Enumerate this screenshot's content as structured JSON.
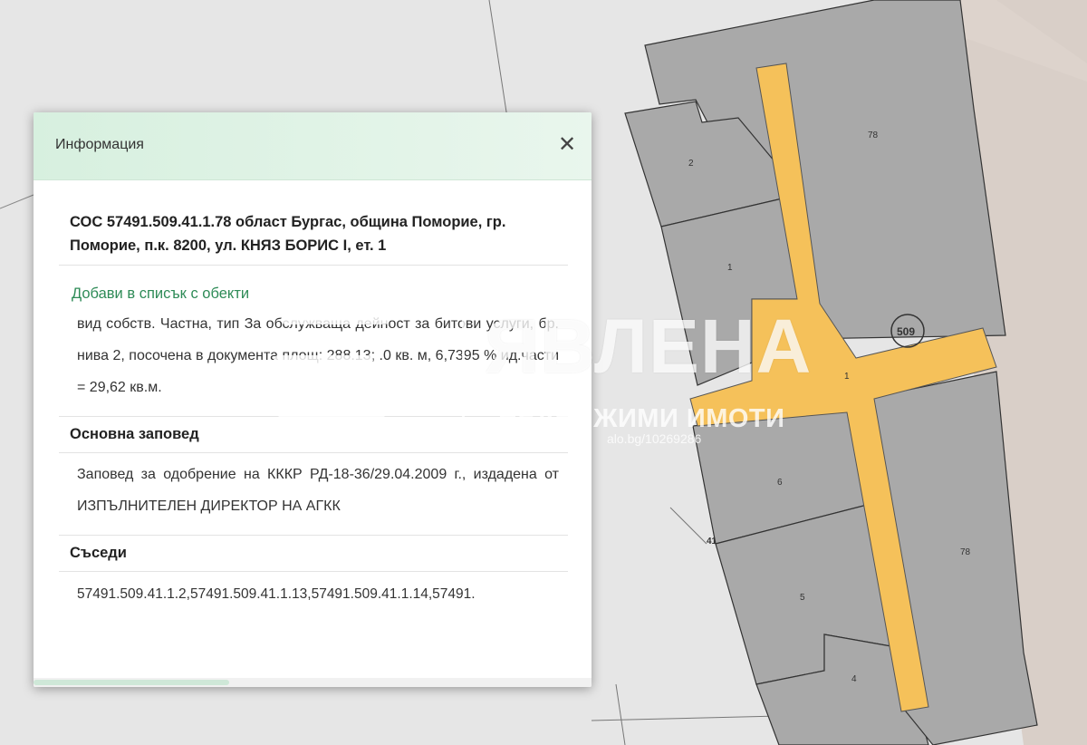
{
  "popup": {
    "title": "Информация",
    "close_symbol": "✕",
    "heading": "СОС 57491.509.41.1.78 област Бургас, община Поморие, гр. Поморие, п.к. 8200, ул. КНЯЗ БОРИС I, ет. 1",
    "add_link": "Добави в списък с обекти",
    "description": "вид собств. Частна, тип За обслужваща дейност за битови услуги, бр. нива 2, посочена в документа площ: 288.13; .0 кв. м, 6,7395 % ид.части = 29,62 кв.м.",
    "order_title": "Основна заповед",
    "order_text": "Заповед за одобрение на КККР РД-18-36/29.04.2009 г., издадена от ИЗПЪЛНИТЕЛЕН ДИРЕКТОР НА АГКК",
    "neighbors_title": "Съседи",
    "neighbors_text": "57491.509.41.1.2,57491.509.41.1.13,57491.509.41.1.14,57491."
  },
  "map": {
    "labels": {
      "unit_78_top": "78",
      "unit_2": "2",
      "unit_1_left": "1",
      "parcel_509": "509",
      "corridor_1": "1",
      "unit_6": "6",
      "plot_41": "41",
      "unit_78_bottom": "78",
      "unit_5": "5",
      "unit_4": "4"
    },
    "colors": {
      "background": "#e6e6e6",
      "building": "#a9a9a9",
      "corridor": "#f5c15a",
      "road": "#d9cfc8"
    }
  },
  "watermark": {
    "brand": "ЯВЛЕНА",
    "subtitle": "НЕДВИЖИМИ ИМОТИ",
    "code": "alo.bg/10269286"
  }
}
